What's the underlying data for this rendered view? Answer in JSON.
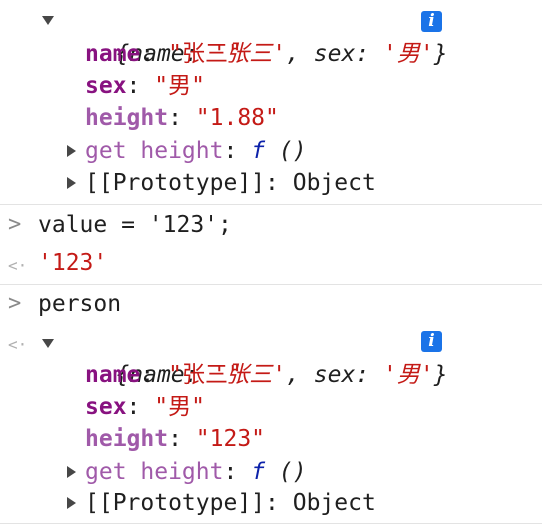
{
  "entries": [
    {
      "summary": {
        "open": "{",
        "k1": "name",
        "v1": "'张三'",
        "sep": ",",
        "k2": "sex",
        "v2": "'男'",
        "close": "}"
      },
      "info_icon": "i",
      "props": [
        {
          "key": "name",
          "value": "\"张三\""
        },
        {
          "key": "sex",
          "value": "\"男\""
        },
        {
          "key": "height",
          "value": "\"1.88\""
        }
      ],
      "getter": {
        "key": "get height",
        "fn": "f",
        "parens": "()"
      },
      "prototype": {
        "key": "[[Prototype]]",
        "value": "Object"
      }
    }
  ],
  "command_1": "value = '123';",
  "result_1": "'123'",
  "command_2": "person",
  "entry2": {
    "summary": {
      "open": "{",
      "k1": "name",
      "v1": "'张三'",
      "sep": ",",
      "k2": "sex",
      "v2": "'男'",
      "close": "}"
    },
    "info_icon": "i",
    "props": [
      {
        "key": "name",
        "value": "\"张三\""
      },
      {
        "key": "sex",
        "value": "\"男\""
      },
      {
        "key": "height",
        "value": "\"123\""
      }
    ],
    "getter": {
      "key": "get height",
      "fn": "f",
      "parens": "()"
    },
    "prototype": {
      "key": "[[Prototype]]",
      "value": "Object"
    }
  },
  "colors": {
    "own_key": "#881280",
    "accessor_key": "#a05aa9",
    "string": "#c41a16",
    "function_keyword": "#0d22aa",
    "info_badge": "#1a73e8"
  }
}
